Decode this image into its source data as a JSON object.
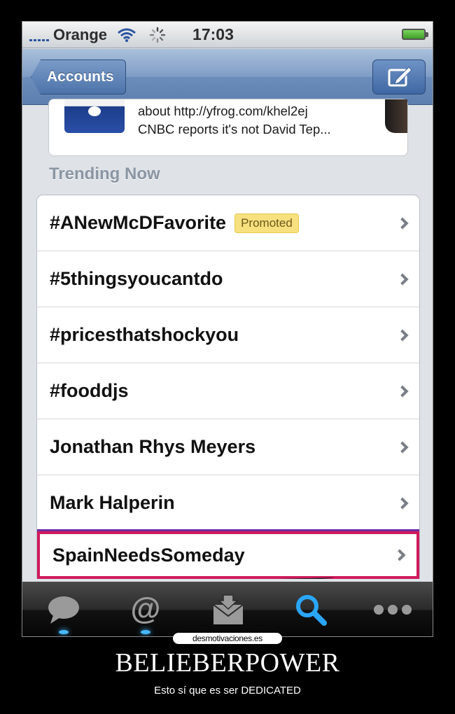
{
  "status_bar": {
    "carrier": "Orange",
    "time": "17:03",
    "icons": [
      "signal-icon",
      "wifi-icon",
      "activity-spinner-icon",
      "battery-icon"
    ]
  },
  "nav_bar": {
    "back_label": "Accounts",
    "compose_icon": "compose-icon"
  },
  "tweet_preview": {
    "lines": [
      "about http://yfrog.com/khel2ej",
      "CNBC reports it's not David Tep..."
    ]
  },
  "trending": {
    "header": "Trending Now",
    "items": [
      {
        "label": "#ANewMcDFavorite",
        "badge": "Promoted"
      },
      {
        "label": "#5thingsyoucantdo"
      },
      {
        "label": "#pricesthatshockyou"
      },
      {
        "label": "#fooddjs"
      },
      {
        "label": "Jonathan Rhys Meyers"
      },
      {
        "label": "Mark Halperin"
      },
      {
        "label": "SpainNeedsSomeday"
      }
    ]
  },
  "tab_bar": {
    "tabs": [
      "timeline-icon",
      "mentions-icon",
      "messages-icon",
      "search-icon",
      "more-icon"
    ],
    "active": "search-icon"
  },
  "poster": {
    "watermark": "desmotivaciones.es",
    "title": "BELIEBERPOWER",
    "subtitle": "Esto sí que es ser DEDICATED"
  },
  "colors": {
    "highlight_border": "#d01a5c",
    "highlight_outer": "#6d2ea3",
    "promoted_badge": "#f7e07e",
    "nav_blue": "#6b8dbb",
    "tab_glow": "#49b8ff"
  }
}
